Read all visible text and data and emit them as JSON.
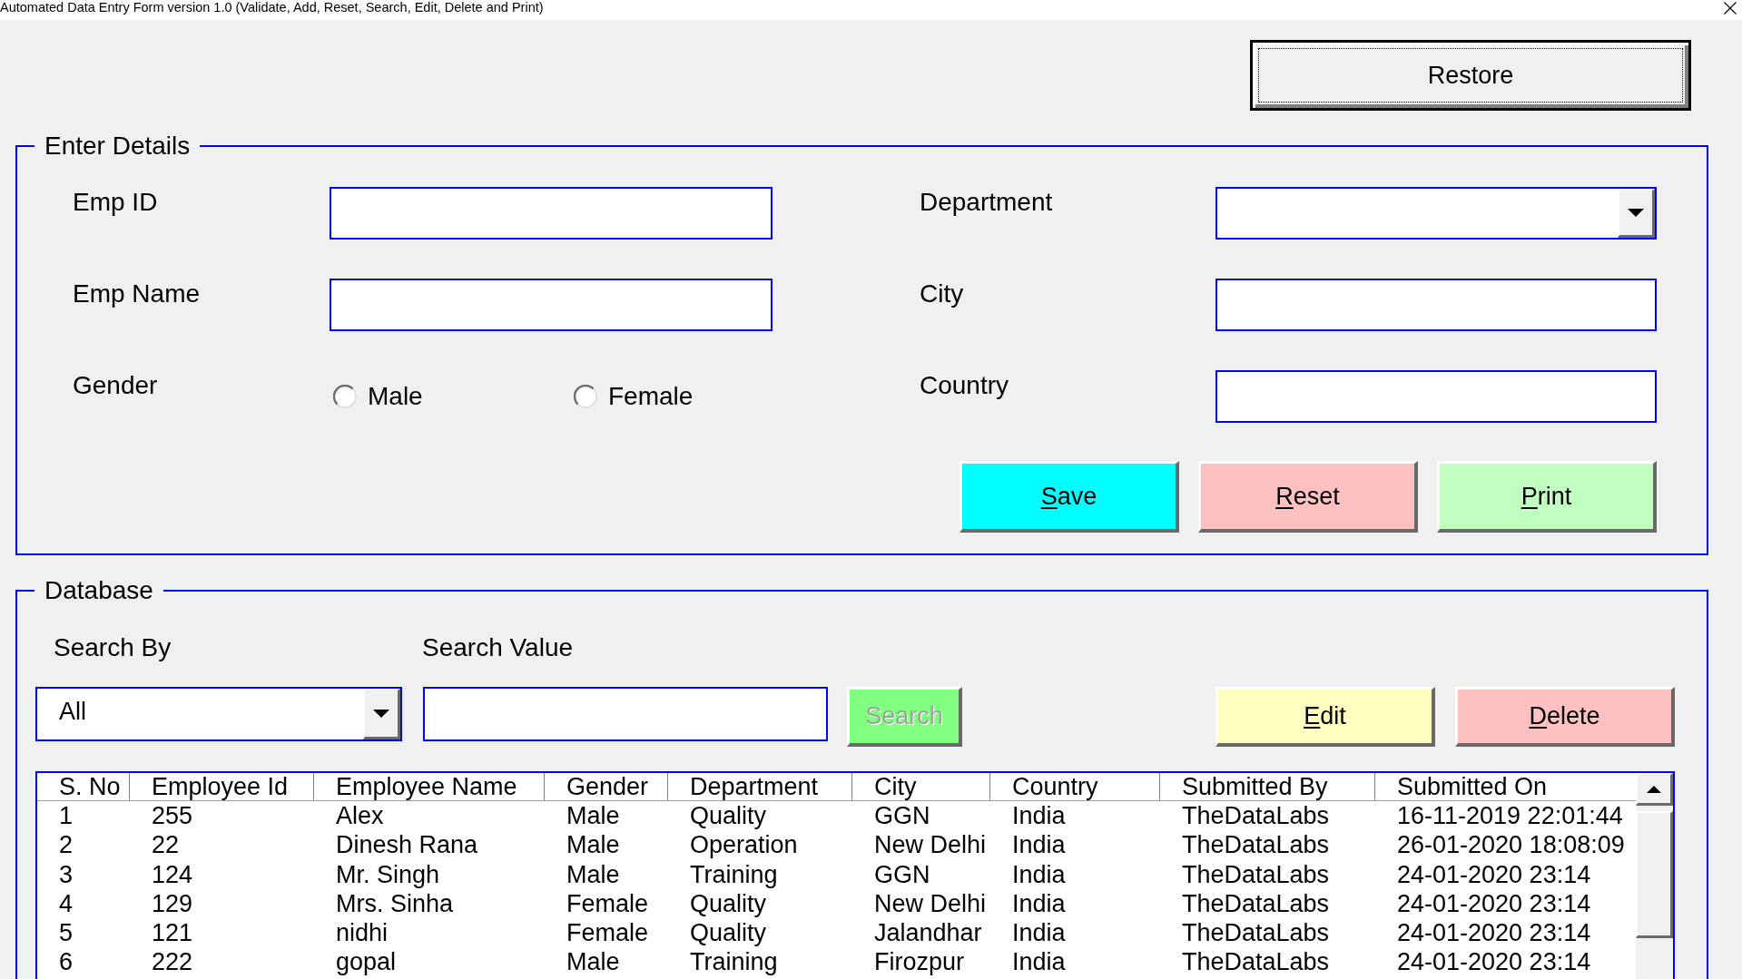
{
  "window": {
    "title": "Automated Data Entry Form version 1.0 (Validate, Add, Reset, Search, Edit, Delete and Print)"
  },
  "restore_button": {
    "label": "Restore"
  },
  "enter_details": {
    "title": "Enter Details",
    "fields": [
      {
        "label": "Emp ID",
        "kind": "text"
      },
      {
        "label": "Department",
        "kind": "dropdown"
      },
      {
        "label": "Emp Name",
        "kind": "text"
      },
      {
        "label": "City",
        "kind": "text"
      },
      {
        "label": "Gender",
        "kind": "radio",
        "options": [
          {
            "label": "Male",
            "selected": false
          },
          {
            "label": "Female",
            "selected": false
          }
        ]
      },
      {
        "label": "Country",
        "kind": "text"
      }
    ],
    "buttons": [
      {
        "label": "Save",
        "color": "#00ffff",
        "mnemonic": true
      },
      {
        "label": "Reset",
        "color": "#ffc0c0",
        "mnemonic": true
      },
      {
        "label": "Print",
        "color": "#c0ffc0",
        "mnemonic": true
      }
    ]
  },
  "database": {
    "title": "Database",
    "search_by": {
      "label": "Search By",
      "value": "All"
    },
    "search_value": {
      "label": "Search Value"
    },
    "search_button": {
      "label": "Search",
      "disabled": true
    },
    "buttons": [
      {
        "label": "Edit",
        "color": "#ffffc0",
        "mnemonic": true
      },
      {
        "label": "Delete",
        "color": "#ffc0c0",
        "mnemonic": true
      }
    ],
    "table": {
      "columns": [
        "S. No",
        "Employee Id",
        "Employee Name",
        "Gender",
        "Department",
        "City",
        "Country",
        "Submitted By",
        "Submitted On"
      ],
      "rows": [
        [
          "1",
          "255",
          "Alex",
          "Male",
          "Quality",
          "GGN",
          "India",
          "TheDataLabs",
          "16-11-2019 22:01:44"
        ],
        [
          "2",
          "22",
          "Dinesh Rana",
          "Male",
          "Operation",
          "New Delhi",
          "India",
          "TheDataLabs",
          "26-01-2020 18:08:09"
        ],
        [
          "3",
          "124",
          "Mr. Singh",
          "Male",
          "Training",
          "GGN",
          "India",
          "TheDataLabs",
          "24-01-2020 23:14"
        ],
        [
          "4",
          "129",
          "Mrs. Sinha",
          "Female",
          "Quality",
          "New Delhi",
          "India",
          "TheDataLabs",
          "24-01-2020 23:14"
        ],
        [
          "5",
          "121",
          "nidhi",
          "Female",
          "Quality",
          "Jalandhar",
          "India",
          "TheDataLabs",
          "24-01-2020 23:14"
        ],
        [
          "6",
          "222",
          "gopal",
          "Male",
          "Training",
          "Firozpur",
          "India",
          "TheDataLabs",
          "24-01-2020 23:14"
        ]
      ]
    }
  }
}
